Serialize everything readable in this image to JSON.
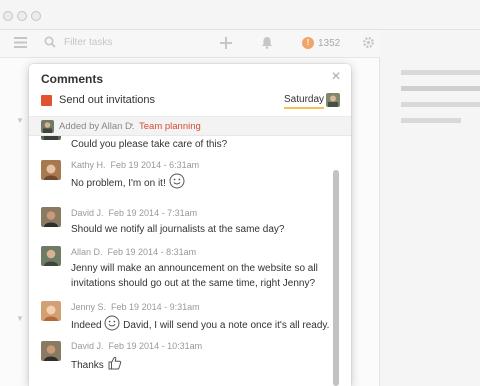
{
  "toolbar": {
    "search_placeholder": "Filter tasks",
    "karma_score": "1352"
  },
  "modal": {
    "title": "Comments",
    "task": {
      "title": "Send out invitations",
      "due": "Saturday"
    },
    "meta": {
      "added_by": "Added by Allan D.",
      "separator": "•",
      "project": "Team planning"
    },
    "comments": [
      {
        "name": "",
        "time": "",
        "text": "Could you please take care of this?"
      },
      {
        "name": "Kathy H.",
        "time": "Feb 19 2014 - 6:31am",
        "text": "No problem, I'm on it!"
      },
      {
        "name": "David J.",
        "time": "Feb 19 2014 - 7:31am",
        "text": "Should we notify all journalists at the same day?"
      },
      {
        "name": "Allan D.",
        "time": "Feb 19 2014 - 8:31am",
        "text_line1": "Jenny will make an announcement on the website so all",
        "text_line2": "invitations should go out at the same time, right Jenny?"
      },
      {
        "name": "Jenny S.",
        "time": "Feb 19 2014 - 9:31am",
        "text_before": "Indeed",
        "text_after": "David, I will send you a note once it's all ready."
      },
      {
        "name": "David J.",
        "time": "Feb 19 2014 - 10:31am",
        "text": "Thanks"
      }
    ]
  },
  "colors": {
    "accent_red": "#e0532e",
    "project_red": "#d84c37",
    "date_underline": "#f2c14e"
  },
  "icons": [
    "menu-icon",
    "search-icon",
    "plus-icon",
    "bell-icon",
    "karma-icon",
    "gear-icon",
    "close-icon",
    "smiley-icon",
    "thumbs-up-icon"
  ]
}
